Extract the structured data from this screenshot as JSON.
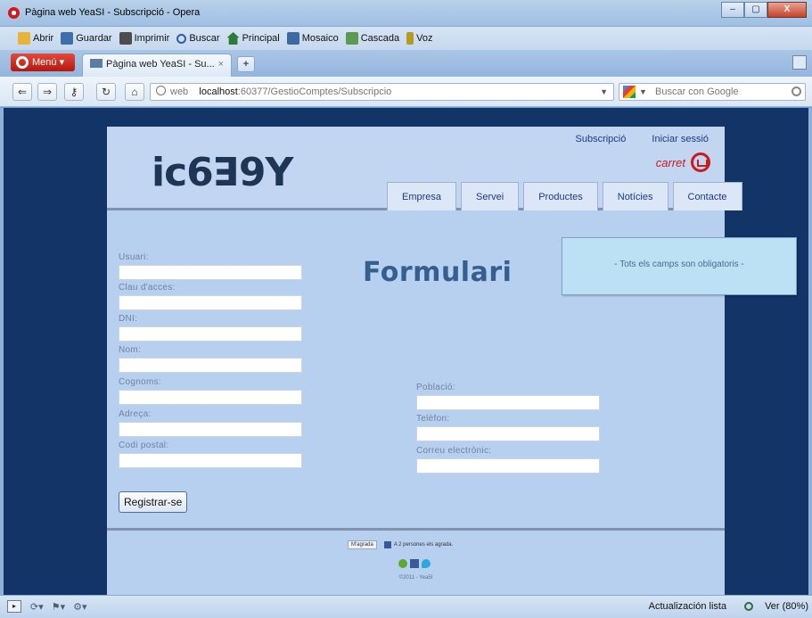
{
  "window": {
    "title": "Pàgina web YeaSI - Subscripció - Opera",
    "buttons": [
      "–",
      "▢",
      "X"
    ]
  },
  "toolbar": {
    "items": [
      {
        "label": "Abrir",
        "icon": "folder-icon"
      },
      {
        "label": "Guardar",
        "icon": "save-icon"
      },
      {
        "label": "Imprimir",
        "icon": "print-icon"
      },
      {
        "label": "Buscar",
        "icon": "search-icon"
      },
      {
        "label": "Principal",
        "icon": "home-icon"
      },
      {
        "label": "Mosaico",
        "icon": "tile-icon"
      },
      {
        "label": "Cascada",
        "icon": "cascade-icon"
      },
      {
        "label": "Voz",
        "icon": "microphone-icon"
      }
    ]
  },
  "tabs": {
    "menu_label": "Menú",
    "active_tab": "Pàgina web YeaSI - Su...",
    "close": "×",
    "new_tab": "+"
  },
  "address": {
    "scheme_label": "web",
    "host": "localhost",
    "path": ":60377/GestioComptes/Subscripcio",
    "search_placeholder": "Buscar con Google"
  },
  "site": {
    "logo_text": "ic6ꓱ9Y",
    "top_links": {
      "subscribe": "Subscripció",
      "login": "Iniciar sessió"
    },
    "cart_label": "carret",
    "nav": [
      "Empresa",
      "Servei",
      "Productes",
      "Notícies",
      "Contacte"
    ],
    "heading": "Formulari",
    "notice": "- Tots els camps son obligatoris -",
    "fields_left": [
      "Usuari:",
      "Clau d'acces:",
      "DNI:",
      "Nom:",
      "Cognoms:",
      "Adreça:",
      "Codi postal:"
    ],
    "fields_right": [
      "Població:",
      "Telèfon:",
      "Correu electrònic:"
    ],
    "register_button": "Registrar-se",
    "footer": {
      "like_button": "M'agrada",
      "like_text": "A 2 persones els agrada.",
      "copyright": "©2011 - Yea5I"
    }
  },
  "statusbar": {
    "status_text": "Actualización lista",
    "zoom_label": "Ver (80%)"
  }
}
